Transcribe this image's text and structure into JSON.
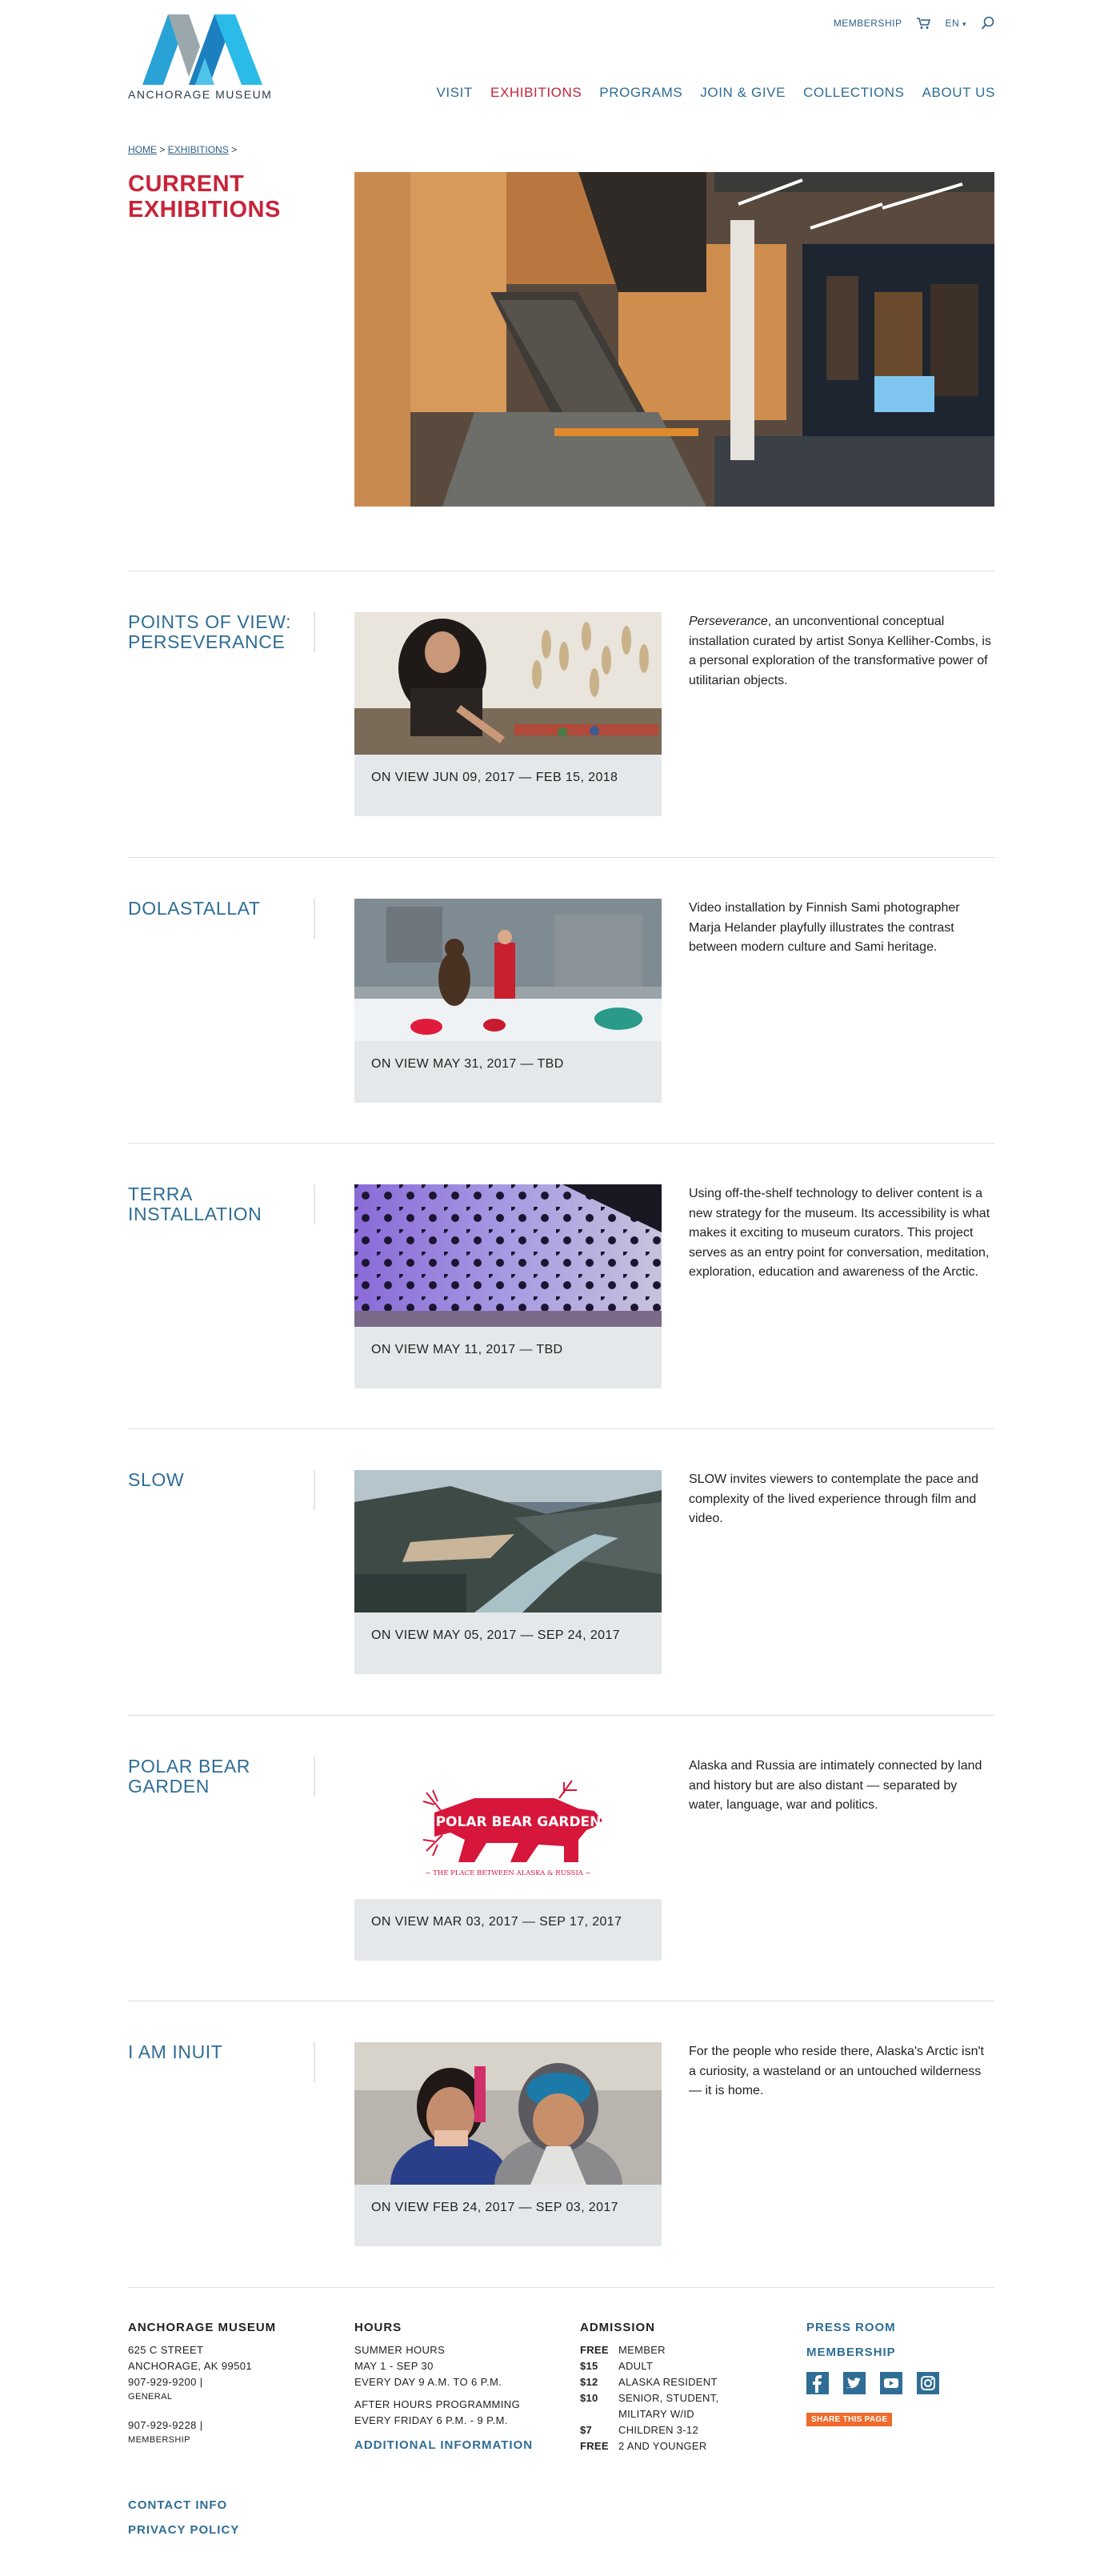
{
  "header": {
    "logo_text": "ANCHORAGE MUSEUM",
    "utility": {
      "membership": "MEMBERSHIP",
      "lang": "EN",
      "lang_caret": "▾"
    },
    "nav": [
      "VISIT",
      "EXHIBITIONS",
      "PROGRAMS",
      "JOIN & GIVE",
      "COLLECTIONS",
      "ABOUT US"
    ],
    "active_nav": "EXHIBITIONS"
  },
  "breadcrumb": {
    "home": "HOME",
    "sep": ">",
    "exhibitions": "EXHIBITIONS"
  },
  "page_title": "CURRENT EXHIBITIONS",
  "exhibitions": [
    {
      "title": "POINTS OF VIEW: PERSEVERANCE",
      "on_view": "ON VIEW JUN 09, 2017 — FEB 15, 2018",
      "desc_em": "Perseverance",
      "desc": ", an unconventional conceptual installation curated by artist Sonya Kelliher-Combs, is a personal exploration of the transformative power of utilitarian objects."
    },
    {
      "title": "DOLASTALLAT",
      "on_view": "ON VIEW MAY 31, 2017 — TBD",
      "desc_em": "",
      "desc": "Video installation by Finnish Sami photographer Marja Helander playfully illustrates the contrast between modern culture and Sami heritage."
    },
    {
      "title": "TERRA INSTALLATION",
      "on_view": "ON VIEW MAY 11, 2017 — TBD",
      "desc_em": "",
      "desc": "Using off-the-shelf technology to deliver content is a new strategy for the museum. Its accessibility is what makes it exciting to museum curators. This project serves as an entry point for conversation, meditation, exploration, education and awareness of the Arctic."
    },
    {
      "title": "SLOW",
      "on_view": "ON VIEW MAY 05, 2017 — SEP 24, 2017",
      "desc_em": "",
      "desc": "SLOW invites viewers to contemplate the pace and complexity of the lived experience through film and video."
    },
    {
      "title": "POLAR BEAR GARDEN",
      "on_view": "ON VIEW MAR 03, 2017 — SEP 17, 2017",
      "desc_em": "",
      "desc": "Alaska and Russia are intimately connected by land and history but are also distant — separated by water, language, war and politics.",
      "logo_title": "POLAR BEAR GARDEN",
      "logo_sub": "~ THE PLACE BETWEEN ALASKA & RUSSIA ~"
    },
    {
      "title": "I AM INUIT",
      "on_view": "ON VIEW FEB 24, 2017 — SEP 03, 2017",
      "desc_em": "",
      "desc": "For the people who reside there, Alaska's Arctic isn't a curiosity, a wasteland or an untouched wilderness — it is home."
    }
  ],
  "footer": {
    "museum": {
      "heading": "ANCHORAGE MUSEUM",
      "street": "625 C STREET",
      "city": "ANCHORAGE, AK 99501",
      "phone1": "907-929-9200 |",
      "phone1_label": "GENERAL",
      "phone2": "907-929-9228 |",
      "phone2_label": "MEMBERSHIP"
    },
    "hours": {
      "heading": "HOURS",
      "l1": "SUMMER HOURS",
      "l2": "MAY 1 - SEP 30",
      "l3": "EVERY DAY 9 A.M. TO 6 P.M.",
      "l4": "AFTER HOURS PROGRAMMING",
      "l5": "EVERY FRIDAY 6 P.M. - 9 P.M.",
      "more": "ADDITIONAL INFORMATION"
    },
    "admission": {
      "heading": "ADMISSION",
      "rows": [
        {
          "price": "FREE",
          "label": "MEMBER"
        },
        {
          "price": "$15",
          "label": "ADULT"
        },
        {
          "price": "$12",
          "label": "ALASKA RESIDENT"
        },
        {
          "price": "$10",
          "label": "SENIOR, STUDENT, MILITARY W/ID"
        },
        {
          "price": "$7",
          "label": "CHILDREN 3-12"
        },
        {
          "price": "FREE",
          "label": "2 AND YOUNGER"
        }
      ]
    },
    "links": {
      "press": "PRESS ROOM",
      "membership": "MEMBERSHIP",
      "share": "SHARE THIS PAGE"
    },
    "bottom": {
      "contact": "CONTACT INFO",
      "privacy": "PRIVACY POLICY"
    }
  },
  "colors": {
    "accent_red": "#c8243a",
    "link_blue": "#2f6d95",
    "card_gray": "#e5e8ea",
    "share_orange": "#ef6a2c"
  },
  "icons": [
    "cart-icon",
    "search-icon",
    "facebook-icon",
    "twitter-icon",
    "youtube-icon",
    "instagram-icon"
  ]
}
